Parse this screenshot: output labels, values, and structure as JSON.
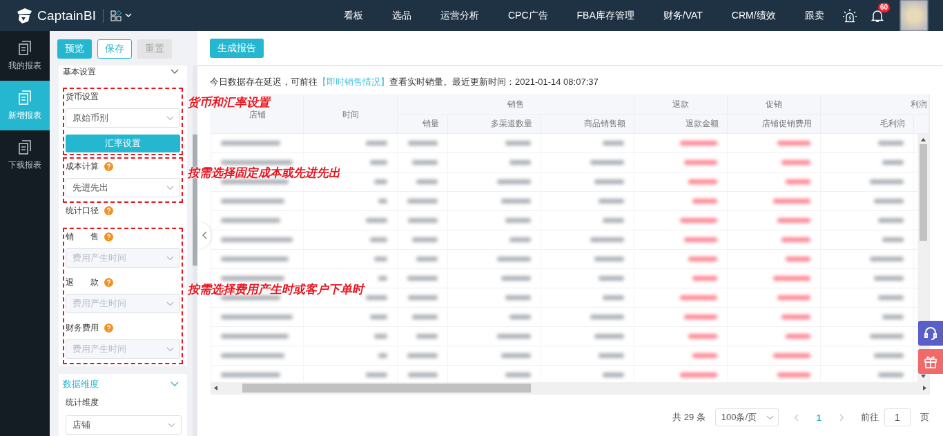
{
  "logo": {
    "text": "CaptainBI"
  },
  "nav": [
    "看板",
    "选品",
    "运营分析",
    "CPC广告",
    "FBA库存管理",
    "财务/VAT",
    "CRM/绩效",
    "跟卖"
  ],
  "notifications": {
    "badge": "60"
  },
  "rail": [
    {
      "label": "我的报表",
      "selected": false
    },
    {
      "label": "新增报表",
      "selected": true
    },
    {
      "label": "下载报表",
      "selected": false
    }
  ],
  "toolbar": [
    {
      "label": "预览",
      "kind": "primary"
    },
    {
      "label": "保存",
      "kind": "outline"
    },
    {
      "label": "重置",
      "kind": "disabled"
    }
  ],
  "basic_settings": {
    "title": "基本设置",
    "blocks": [
      {
        "kind": "annotated",
        "note": "货币和汇率设置",
        "items": [
          {
            "kind": "label",
            "text": "货币设置",
            "help": false
          },
          {
            "kind": "select",
            "value": "原始币别",
            "disabled": false
          },
          {
            "kind": "button",
            "text": "汇率设置"
          }
        ]
      },
      {
        "kind": "annotated",
        "note": "按需选择固定成本或先进先出",
        "items": [
          {
            "kind": "label",
            "text": "成本计算",
            "help": true
          },
          {
            "kind": "select",
            "value": "先进先出",
            "disabled": false
          }
        ]
      },
      {
        "kind": "label",
        "text": "统计口径",
        "help": true
      },
      {
        "kind": "annotated",
        "note": "按需选择费用产生时或客户下单时",
        "items": [
          {
            "kind": "label",
            "text": "销　　售",
            "help": true
          },
          {
            "kind": "select",
            "value": "费用产生时间",
            "disabled": true
          },
          {
            "kind": "label",
            "text": "退　　款",
            "help": true
          },
          {
            "kind": "select",
            "value": "费用产生时间",
            "disabled": true
          },
          {
            "kind": "label",
            "text": "财务费用",
            "help": true
          },
          {
            "kind": "select",
            "value": "费用产生时间",
            "disabled": true
          }
        ]
      }
    ]
  },
  "data_dimension": {
    "title": "数据维度",
    "label": "统计维度",
    "value": "店铺"
  },
  "generate_button": "生成报告",
  "notice": {
    "before": "今日数据存在延迟，可前往",
    "link": "【即时销售情况】",
    "after": "查看实时销量。最近更新时间：2021-01-14 08:07:37"
  },
  "table": {
    "groups": [
      {
        "label": "店铺"
      },
      {
        "label": "时间"
      },
      {
        "label": "销售",
        "columns": [
          {
            "label": "销量",
            "kind": "number"
          },
          {
            "label": "多渠道数量",
            "kind": "number"
          },
          {
            "label": "商品销售额",
            "kind": "number"
          }
        ]
      },
      {
        "label": "退款",
        "columns": [
          {
            "label": "退款金额",
            "kind": "negative"
          }
        ]
      },
      {
        "label": "促销",
        "columns": [
          {
            "label": "店铺促销费用",
            "kind": "negative"
          }
        ]
      },
      {
        "label": "利润",
        "columns": [
          {
            "label": "毛利润",
            "kind": "number"
          }
        ]
      }
    ]
  },
  "pagination": {
    "total": "共 29 条",
    "page_size": "100条/页",
    "pages": [
      {
        "label": "1",
        "selected": true
      }
    ],
    "goto_label": "前往",
    "goto_value": "1",
    "page_suffix": "页"
  }
}
